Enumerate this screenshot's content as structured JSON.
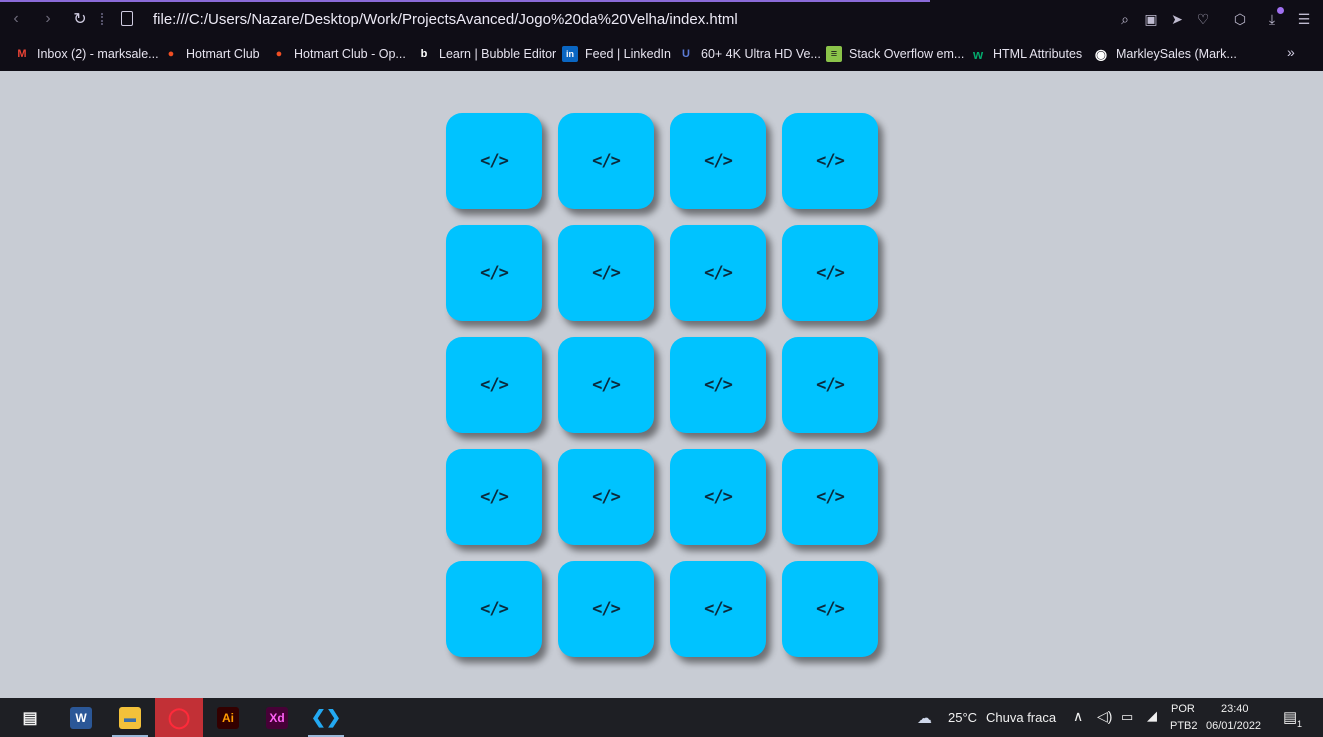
{
  "browser": {
    "url": "file:///C:/Users/Nazare/Desktop/Work/ProjectsAvanced/Jogo%20da%20Velha/index.html",
    "accent": "#8a6ad8"
  },
  "bookmarks": [
    {
      "label": "Inbox (2) - marksale...",
      "icon": "gmail-icon",
      "glyph": "M",
      "color": "#ea4335"
    },
    {
      "label": "Hotmart Club",
      "icon": "hotmart-icon",
      "glyph": "●",
      "color": "#f04e23"
    },
    {
      "label": "Hotmart Club - Op...",
      "icon": "hotmart-icon",
      "glyph": "●",
      "color": "#f04e23"
    },
    {
      "label": "Learn | Bubble Editor",
      "icon": "bubble-icon",
      "glyph": "b",
      "color": "#ffffff"
    },
    {
      "label": "Feed | LinkedIn",
      "icon": "linkedin-icon",
      "glyph": "in",
      "color": "#0a66c2"
    },
    {
      "label": "60+ 4K Ultra HD Ve...",
      "icon": "site-icon",
      "glyph": "U",
      "color": "#5b7bd5"
    },
    {
      "label": "Stack Overflow em...",
      "icon": "stackoverflow-icon",
      "glyph": "≡",
      "color": "#8bc34a"
    },
    {
      "label": "HTML Attributes",
      "icon": "w3schools-icon",
      "glyph": "w",
      "color": "#04aa6d"
    },
    {
      "label": "MarkleySales (Mark...",
      "icon": "github-icon",
      "glyph": "◉",
      "color": "#ffffff"
    }
  ],
  "board": {
    "cell_glyph": "</>",
    "cell_color": "#00c3ff",
    "rows": 5,
    "cols": 4
  },
  "taskbar": {
    "weather_temp": "25°C",
    "weather_desc": "Chuva fraca",
    "lang_top": "POR",
    "lang_bottom": "PTB2",
    "time": "23:40",
    "date": "06/01/2022",
    "notification_count": "1",
    "apps": [
      {
        "name": "task-view",
        "glyph": "▤"
      },
      {
        "name": "word",
        "glyph": "W",
        "color": "#2b5797"
      },
      {
        "name": "file-explorer",
        "glyph": "▬",
        "color": "#f3c13a"
      },
      {
        "name": "opera",
        "glyph": "O",
        "color": "#ff1b2d"
      },
      {
        "name": "illustrator",
        "glyph": "Ai",
        "color": "#ff9a00"
      },
      {
        "name": "adobe-xd",
        "glyph": "Xd",
        "color": "#ff61f6"
      },
      {
        "name": "vscode",
        "glyph": "‹›",
        "color": "#23a9f2"
      }
    ]
  }
}
